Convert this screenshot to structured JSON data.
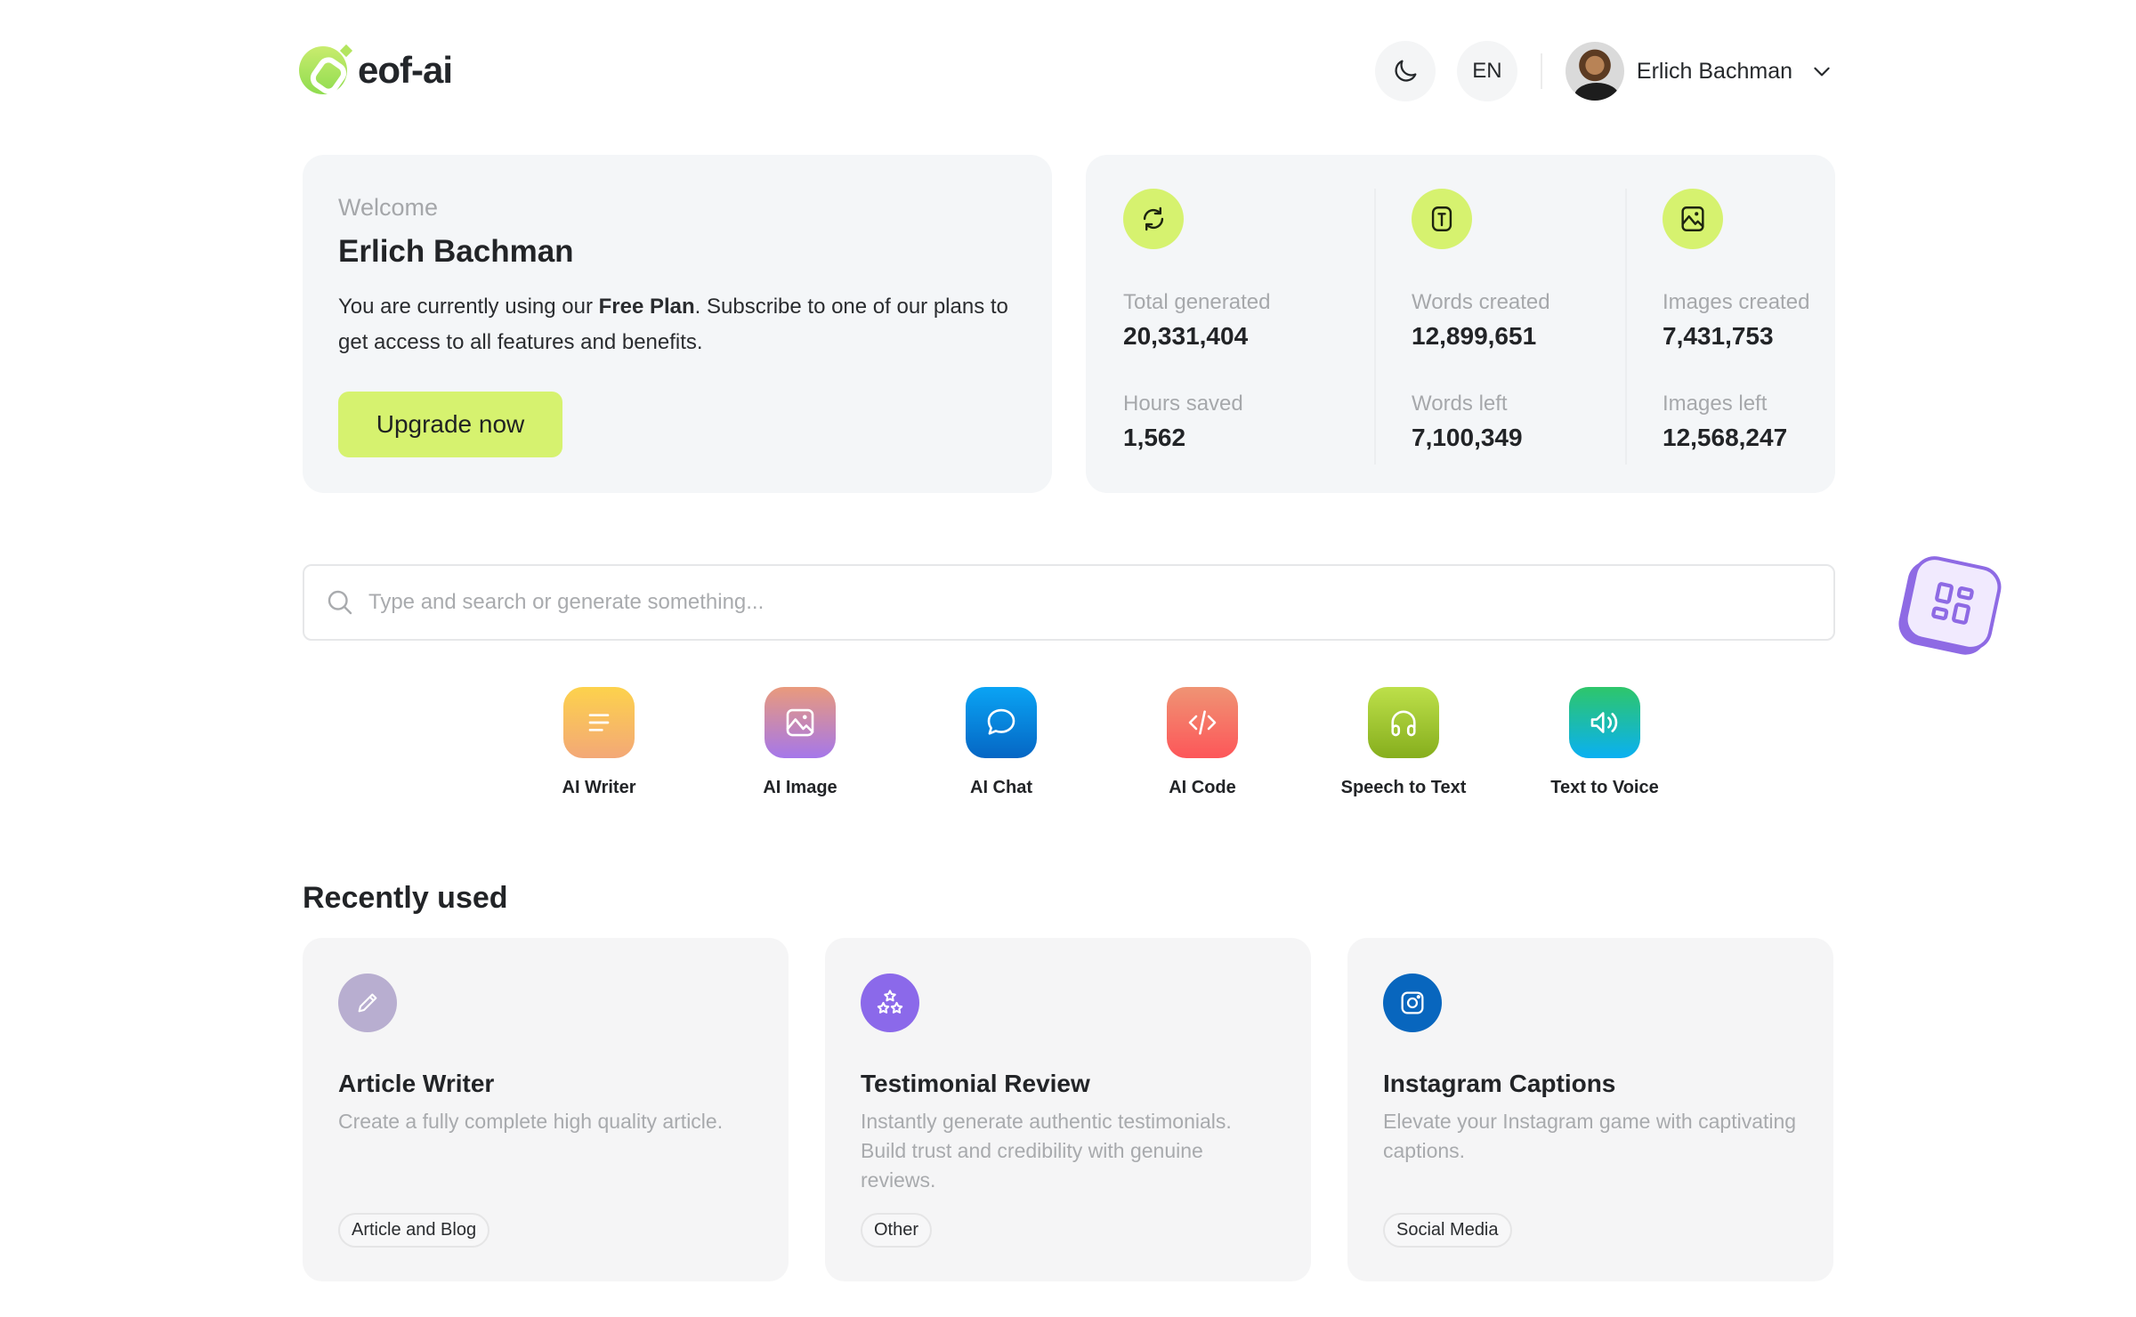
{
  "brand": {
    "name": "eof-ai",
    "accent": "#d6f26f"
  },
  "header": {
    "theme_toggle_icon": "moon-icon",
    "language": "EN",
    "user_name": "Erlich Bachman",
    "user_menu_icon": "chevron-down-icon"
  },
  "welcome": {
    "greeting": "Welcome",
    "name": "Erlich Bachman",
    "desc_prefix": "You are currently using our ",
    "plan": "Free Plan",
    "desc_suffix": ". Subscribe to one of our plans to get access to all features and benefits.",
    "upgrade_label": "Upgrade now"
  },
  "stats": [
    {
      "icon": "refresh-icon",
      "items": [
        {
          "label": "Total generated",
          "value": "20,331,404"
        },
        {
          "label": "Hours saved",
          "value": "1,562"
        }
      ]
    },
    {
      "icon": "text-icon",
      "items": [
        {
          "label": "Words created",
          "value": "12,899,651"
        },
        {
          "label": "Words left",
          "value": "7,100,349"
        }
      ]
    },
    {
      "icon": "image-icon",
      "items": [
        {
          "label": "Images created",
          "value": "7,431,753"
        },
        {
          "label": "Images left",
          "value": "12,568,247"
        }
      ]
    }
  ],
  "search": {
    "placeholder": "Type and search or generate something...",
    "value": ""
  },
  "apps_button_icon": "apps-grid-icon",
  "tools": [
    {
      "label": "AI Writer",
      "icon": "text-lines-icon",
      "colors": [
        "#fdd24c",
        "#f3a877"
      ]
    },
    {
      "label": "AI Image",
      "icon": "image-icon",
      "colors": [
        "#e99a7c",
        "#a577ea"
      ]
    },
    {
      "label": "AI Chat",
      "icon": "chat-bubble-icon",
      "colors": [
        "#0aa4f4",
        "#0566c4"
      ]
    },
    {
      "label": "AI Code",
      "icon": "code-icon",
      "colors": [
        "#ef9474",
        "#fd5659"
      ]
    },
    {
      "label": "Speech to Text",
      "icon": "headphones-icon",
      "colors": [
        "#bde04a",
        "#86ae1d"
      ]
    },
    {
      "label": "Text to Voice",
      "icon": "speaker-icon",
      "colors": [
        "#2ec66a",
        "#0ab0f2"
      ]
    }
  ],
  "recent": {
    "title": "Recently used",
    "items": [
      {
        "title": "Article Writer",
        "desc": "Create a fully complete high quality article.",
        "tag": "Article and Blog",
        "icon": "pencil-icon",
        "color": "#b8aed0"
      },
      {
        "title": "Testimonial Review",
        "desc": "Instantly generate authentic testimonials. Build trust and credibility with genuine reviews.",
        "tag": "Other",
        "icon": "stars-icon",
        "color": "#8b69ea"
      },
      {
        "title": "Instagram Captions",
        "desc": "Elevate your Instagram game with captivating captions.",
        "tag": "Social Media",
        "icon": "instagram-icon",
        "color": "#0866be"
      }
    ]
  }
}
